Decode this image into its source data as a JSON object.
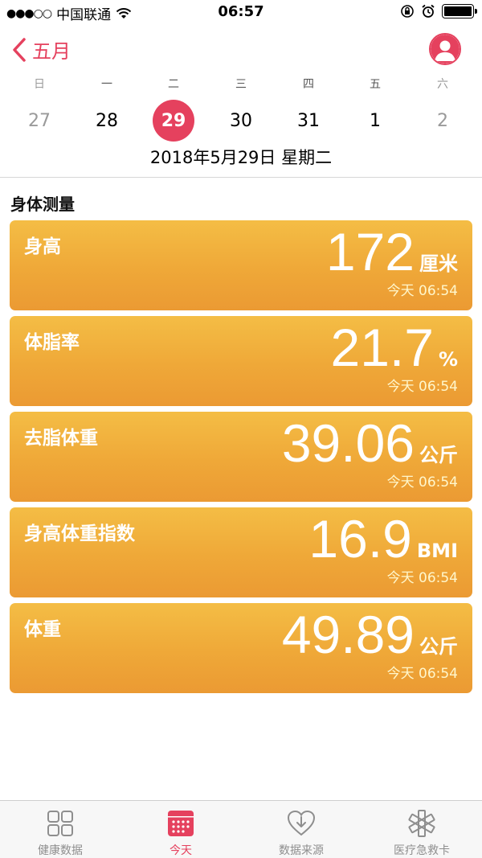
{
  "status_bar": {
    "carrier": "中国联通",
    "time": "06:57"
  },
  "nav": {
    "back_label": "五月"
  },
  "calendar": {
    "weekdays": [
      "日",
      "一",
      "二",
      "三",
      "四",
      "五",
      "六"
    ],
    "dates": [
      "27",
      "28",
      "29",
      "30",
      "31",
      "1",
      "2"
    ],
    "selected_index": 2,
    "full_date": "2018年5月29日 星期二"
  },
  "section": {
    "title": "身体测量"
  },
  "cards": [
    {
      "title": "身高",
      "value": "172",
      "unit": "厘米",
      "time": "今天 06:54"
    },
    {
      "title": "体脂率",
      "value": "21.7",
      "unit": "%",
      "time": "今天 06:54"
    },
    {
      "title": "去脂体重",
      "value": "39.06",
      "unit": "公斤",
      "time": "今天 06:54"
    },
    {
      "title": "身高体重指数",
      "value": "16.9",
      "unit": "BMI",
      "time": "今天 06:54"
    },
    {
      "title": "体重",
      "value": "49.89",
      "unit": "公斤",
      "time": "今天 06:54"
    }
  ],
  "tab_bar": {
    "tabs": [
      {
        "label": "健康数据",
        "icon": "grid-icon"
      },
      {
        "label": "今天",
        "icon": "calendar-icon"
      },
      {
        "label": "数据来源",
        "icon": "heart-download-icon"
      },
      {
        "label": "医疗急救卡",
        "icon": "medical-star-icon"
      }
    ],
    "active_index": 1
  },
  "colors": {
    "accent": "#e5415e",
    "card_top": "#f4bd45",
    "card_bottom": "#eb9a33",
    "tab_inactive": "#8e8e8e"
  }
}
